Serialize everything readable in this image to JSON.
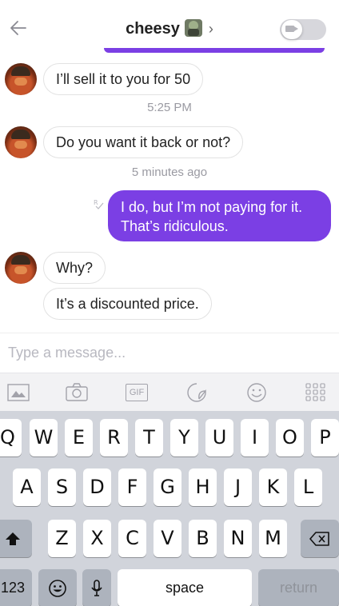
{
  "header": {
    "title": "cheesy",
    "chevron": "›",
    "back_icon": "back-arrow-icon",
    "video_icon": "video-camera-icon"
  },
  "messages": [
    {
      "direction": "incoming",
      "text": "I’ll sell it to you for 50"
    },
    {
      "type": "timestamp",
      "text": "5:25 PM"
    },
    {
      "direction": "incoming",
      "text": "Do you want it back or not?"
    },
    {
      "type": "timestamp",
      "text": "5 minutes ago"
    },
    {
      "direction": "outgoing",
      "lines": [
        "I do, but I’m not paying for it.",
        "That’s ridiculous."
      ]
    },
    {
      "direction": "incoming",
      "text": "Why?"
    },
    {
      "direction": "incoming",
      "text": "It’s a discounted price."
    }
  ],
  "composer": {
    "placeholder": "Type a message..."
  },
  "toolbar": {
    "gif_label": "GIF"
  },
  "keyboard": {
    "row1": [
      "Q",
      "W",
      "E",
      "R",
      "T",
      "Y",
      "U",
      "I",
      "O",
      "P"
    ],
    "row2": [
      "A",
      "S",
      "D",
      "F",
      "G",
      "H",
      "J",
      "K",
      "L"
    ],
    "row3": [
      "Z",
      "X",
      "C",
      "V",
      "B",
      "N",
      "M"
    ],
    "numbers": "123",
    "space": "space",
    "return": "return"
  },
  "colors": {
    "accent": "#7b3fe4"
  }
}
